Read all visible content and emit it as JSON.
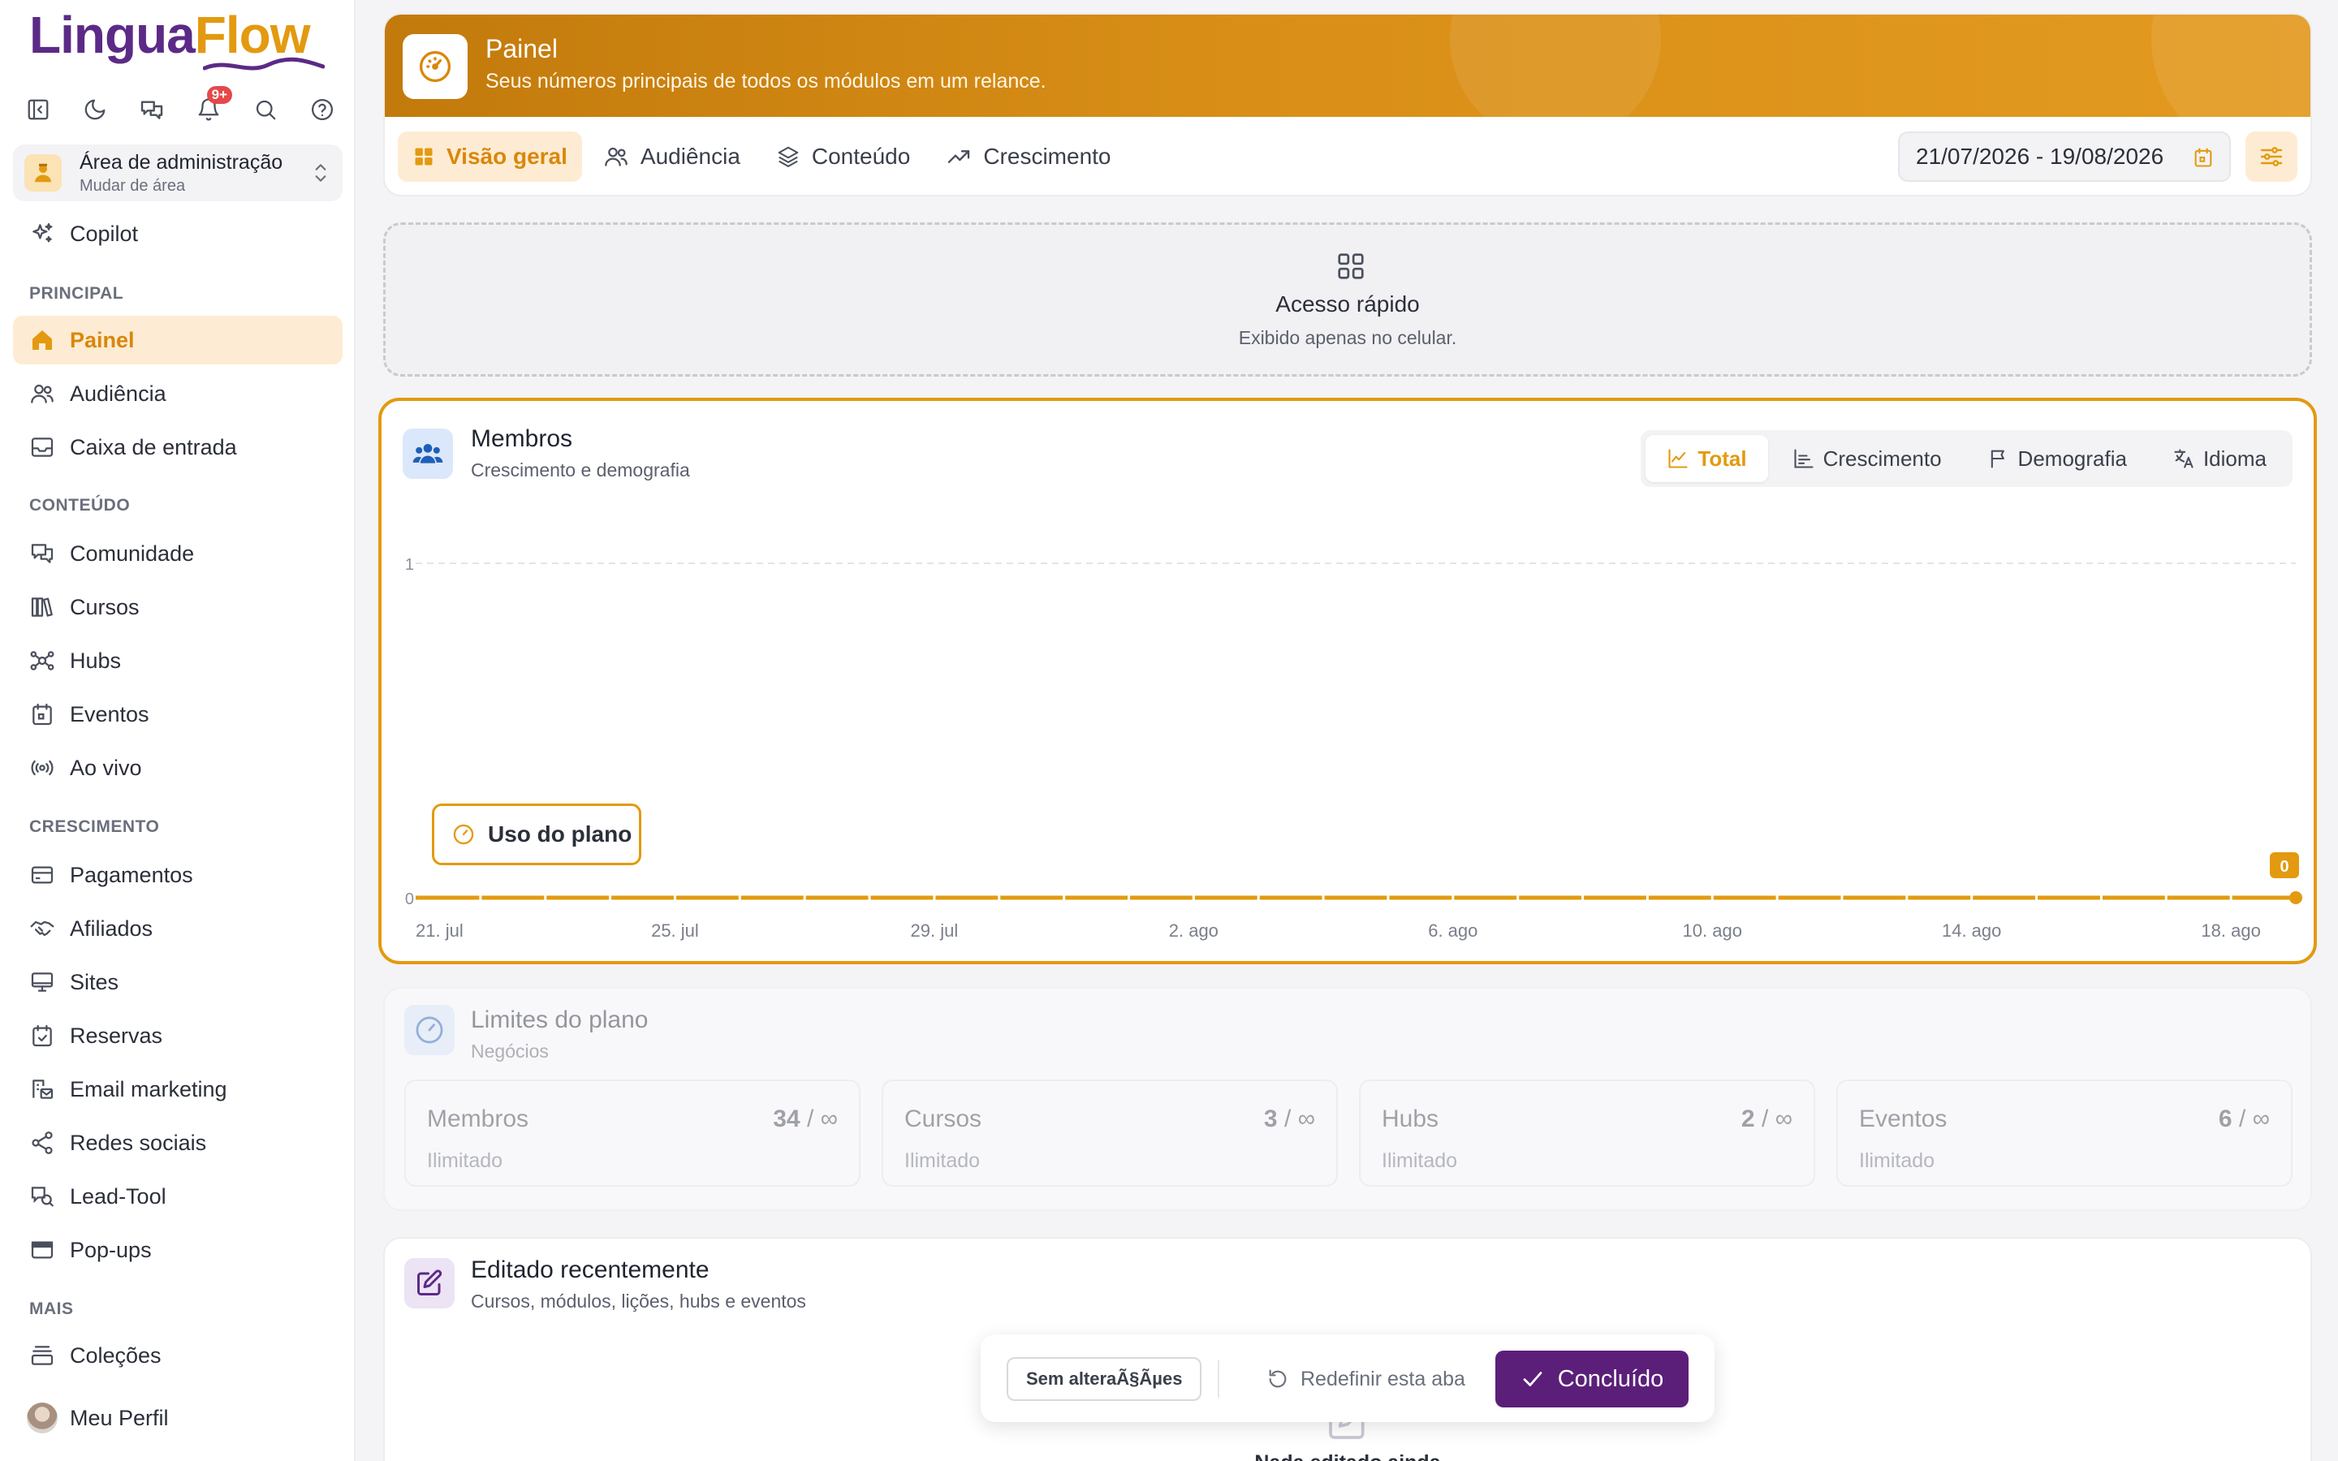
{
  "app": {
    "logo_part1": "Lingua",
    "logo_part2": "Flow",
    "notification_count": "9+",
    "colors": {
      "brand_purple": "#5b2a86",
      "accent": "#e39a10",
      "done_button": "#5b1f79"
    }
  },
  "sidebar": {
    "area": {
      "title": "Área de administração",
      "subtitle": "Mudar de área"
    },
    "copilot": "Copilot",
    "sections": {
      "principal": "PRINCIPAL",
      "conteudo": "CONTEÚDO",
      "crescimento": "CRESCIMENTO",
      "mais": "MAIS"
    },
    "items": {
      "painel": "Painel",
      "audiencia": "Audiência",
      "caixa": "Caixa de entrada",
      "comunidade": "Comunidade",
      "cursos": "Cursos",
      "hubs": "Hubs",
      "eventos": "Eventos",
      "aovivo": "Ao vivo",
      "pagamentos": "Pagamentos",
      "afiliados": "Afiliados",
      "sites": "Sites",
      "reservas": "Reservas",
      "email": "Email marketing",
      "redes": "Redes sociais",
      "leadtool": "Lead-Tool",
      "popups": "Pop-ups",
      "colecoes": "Coleções",
      "perfil": "Meu Perfil"
    }
  },
  "header": {
    "title": "Painel",
    "subtitle": "Seus números principais de todos os módulos em um relance.",
    "tabs": [
      "Visão geral",
      "Audiência",
      "Conteúdo",
      "Crescimento"
    ],
    "date_range": "21/07/2026 - 19/08/2026"
  },
  "quick_access": {
    "title": "Acesso rápido",
    "subtitle": "Exibido apenas no celular."
  },
  "members": {
    "title": "Membros",
    "subtitle": "Crescimento e demografia",
    "views": [
      "Total",
      "Crescimento",
      "Demografia",
      "Idioma"
    ],
    "plan_usage_button": "Uso do plano"
  },
  "chart_data": {
    "type": "line",
    "x": [
      "21. jul",
      "22. jul",
      "23. jul",
      "24. jul",
      "25. jul",
      "26. jul",
      "27. jul",
      "28. jul",
      "29. jul",
      "30. jul",
      "31. jul",
      "1. ago",
      "2. ago",
      "3. ago",
      "4. ago",
      "5. ago",
      "6. ago",
      "7. ago",
      "8. ago",
      "9. ago",
      "10. ago",
      "11. ago",
      "12. ago",
      "13. ago",
      "14. ago",
      "15. ago",
      "16. ago",
      "17. ago",
      "18. ago",
      "19. ago"
    ],
    "xtick_labels": [
      "21. jul",
      "25. jul",
      "29. jul",
      "2. ago",
      "6. ago",
      "10. ago",
      "14. ago",
      "18. ago"
    ],
    "series": [
      {
        "values": [
          0,
          0,
          0,
          0,
          0,
          0,
          0,
          0,
          0,
          0,
          0,
          0,
          0,
          0,
          0,
          0,
          0,
          0,
          0,
          0,
          0,
          0,
          0,
          0,
          0,
          0,
          0,
          0,
          0,
          0
        ]
      }
    ],
    "ylim": [
      0,
      1
    ],
    "ytick_labels": [
      "0",
      "1"
    ],
    "last_value_label": "0",
    "grid": true,
    "series_color": "#e39a10"
  },
  "limits": {
    "title": "Limites do plano",
    "subtitle": "Negócios",
    "items": [
      {
        "name": "Membros",
        "value": "34",
        "max": "/ ∞",
        "note": "Ilimitado"
      },
      {
        "name": "Cursos",
        "value": "3",
        "max": "/ ∞",
        "note": "Ilimitado"
      },
      {
        "name": "Hubs",
        "value": "2",
        "max": "/ ∞",
        "note": "Ilimitado"
      },
      {
        "name": "Eventos",
        "value": "6",
        "max": "/ ∞",
        "note": "Ilimitado"
      }
    ]
  },
  "recent": {
    "title": "Editado recentemente",
    "subtitle": "Cursos, módulos, lições, hubs e eventos",
    "empty": "Nada editado ainda"
  },
  "edit_bar": {
    "status": "Sem alteraÃ§Ãµes",
    "reset": "Redefinir esta aba",
    "done": "Concluído"
  }
}
